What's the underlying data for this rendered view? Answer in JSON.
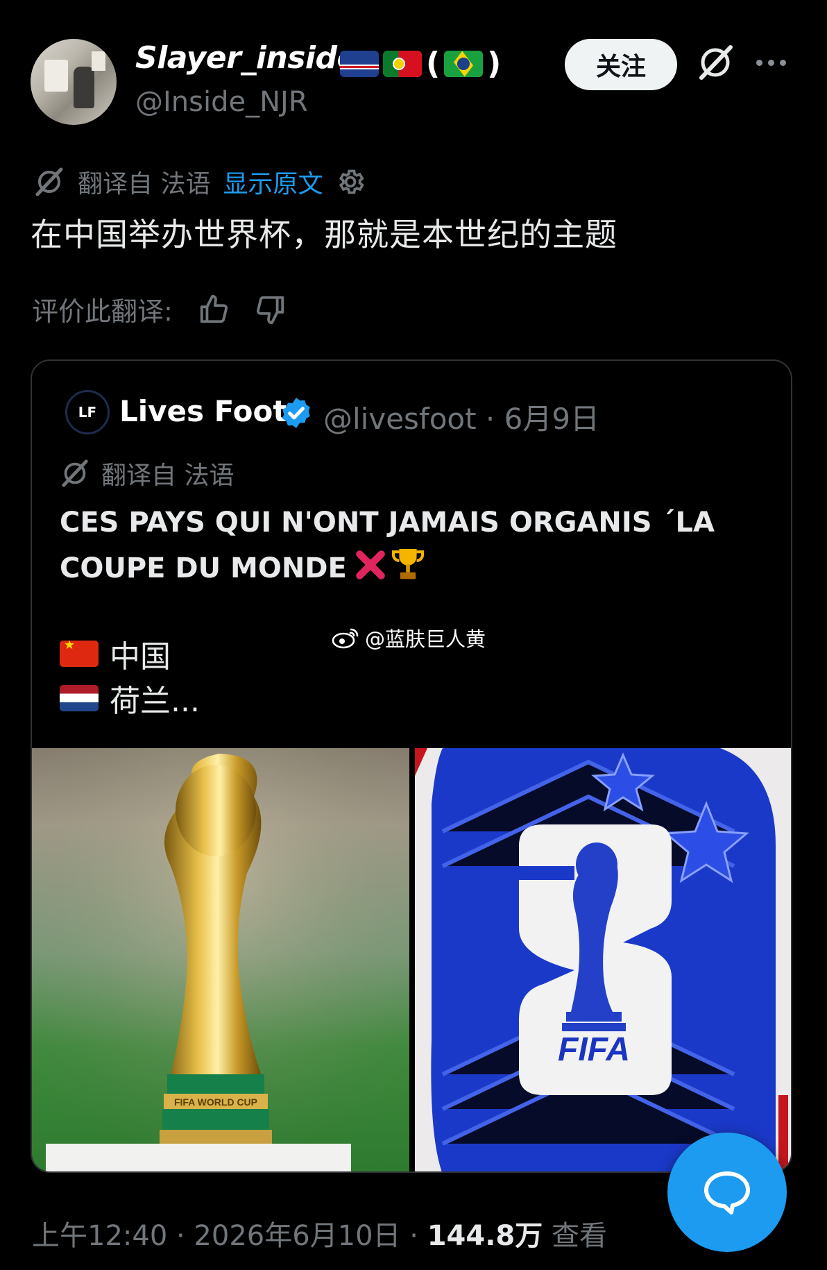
{
  "author": {
    "display_name": "Slayer_inside",
    "paren_open": "(",
    "paren_close": ")",
    "handle": "@Inside_NJR",
    "flag_icons": [
      "cape-verde-flag-icon",
      "portugal-flag-icon",
      "brazil-flag-icon"
    ]
  },
  "header": {
    "follow_label": "关注"
  },
  "translation": {
    "translated_from": "翻译自 法语",
    "show_original": "显示原文",
    "text": "在中国举办世界杯，那就是本世纪的主题",
    "rate_label": "评价此翻译:"
  },
  "quote": {
    "avatar_text": "LF",
    "name": "Lives Foot",
    "handle_date": "@livesfoot · 6月9日",
    "translated_from": "翻译自 法语",
    "text": "CES PAYS QUI N'ONT JAMAIS ORGANIS ´LA COUPE DU MONDE",
    "emojis": [
      "cross-mark-icon",
      "trophy-icon"
    ],
    "countries": [
      {
        "flag": "china-flag-icon",
        "name": "中国"
      },
      {
        "flag": "netherlands-flag-icon",
        "name": "荷兰..."
      }
    ],
    "watermark": "@蓝肤巨人黄",
    "images": [
      {
        "name": "world-cup-trophy-image",
        "caption": "FIFA WORLD CUP"
      },
      {
        "name": "fifa-2026-logo-image",
        "caption": "FIFA"
      }
    ]
  },
  "meta": {
    "time_date": "上午12:40 · 2026年6月10日 · ",
    "views": "144.8万",
    "views_label": " 查看"
  },
  "colors": {
    "background": "#000000",
    "link": "#1d9bf0",
    "muted": "#71767b",
    "text": "#e7e9ea"
  }
}
